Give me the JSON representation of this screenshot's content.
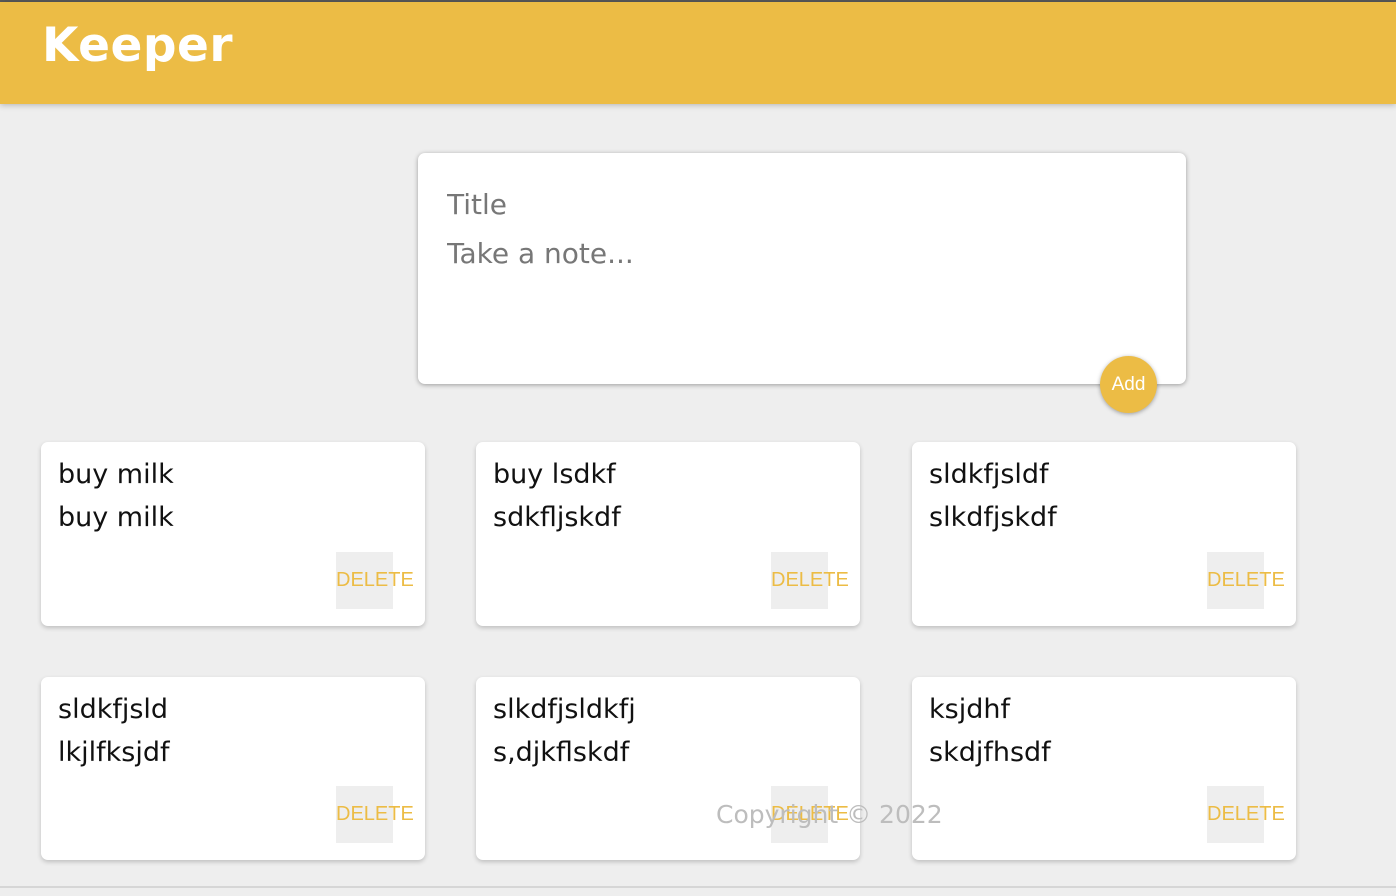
{
  "header": {
    "app_title": "Keeper"
  },
  "create_area": {
    "title_placeholder": "Title",
    "content_placeholder": "Take a note...",
    "add_label": "Add"
  },
  "notes": [
    {
      "title": "buy milk",
      "content": "buy milk",
      "delete_label": "DELETE"
    },
    {
      "title": "buy lsdkf",
      "content": "sdkfljskdf",
      "delete_label": "DELETE"
    },
    {
      "title": "sldkfjsldf",
      "content": "slkdfjskdf",
      "delete_label": "DELETE"
    },
    {
      "title": "sldkfjsld",
      "content": "lkjlfksjdf",
      "delete_label": "DELETE"
    },
    {
      "title": "slkdfjsldkfj",
      "content": "s,djkflskdf",
      "delete_label": "DELETE"
    },
    {
      "title": "ksjdhf",
      "content": "skdjfhsdf",
      "delete_label": "DELETE"
    }
  ],
  "footer": {
    "copyright": "Copyright © 2022"
  },
  "colors": {
    "accent": "#ecbc45",
    "background": "#eeeeee",
    "card": "#ffffff"
  }
}
